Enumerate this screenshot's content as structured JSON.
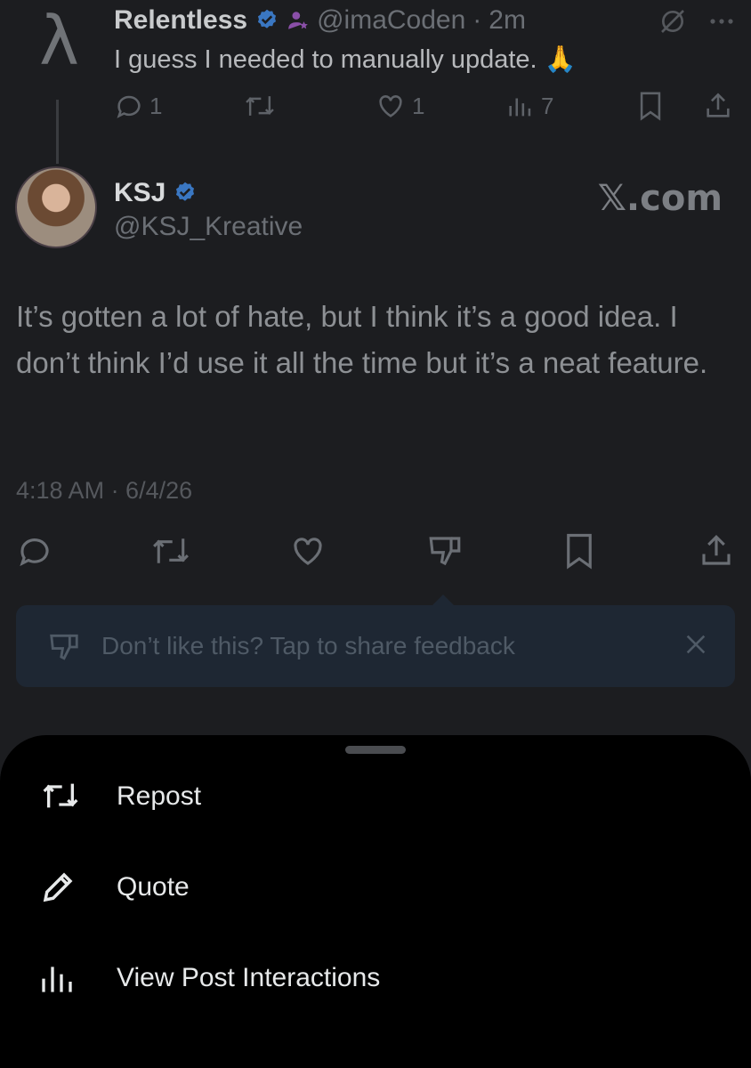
{
  "parent_post": {
    "avatar_glyph": "λ",
    "name": "Relentless",
    "handle": "@imaCoden",
    "time": "2m",
    "separator": "·",
    "text": "I guess I needed to manually update. 🙏",
    "replies": "1",
    "likes": "1",
    "views": "7"
  },
  "main_post": {
    "name": "KSJ",
    "handle": "@KSJ_Kreative",
    "watermark": "𝕏.com",
    "text": "It’s gotten a lot of hate, but I think it’s a good idea. I don’t think I’d use it all the time but it’s a neat feature.",
    "timestamp": "4:18 AM · 6/4/26"
  },
  "feedback_prompt": {
    "text": "Don’t like this? Tap to share feedback"
  },
  "sheet": {
    "items": [
      {
        "label": "Repost",
        "icon": "repost-icon"
      },
      {
        "label": "Quote",
        "icon": "pencil-icon"
      },
      {
        "label": "View Post Interactions",
        "icon": "analytics-icon"
      }
    ]
  },
  "colors": {
    "background": "#1c1d20",
    "sheet": "#000000",
    "verified": "#1d9bf0",
    "feedback_bg": "#1e2733"
  }
}
